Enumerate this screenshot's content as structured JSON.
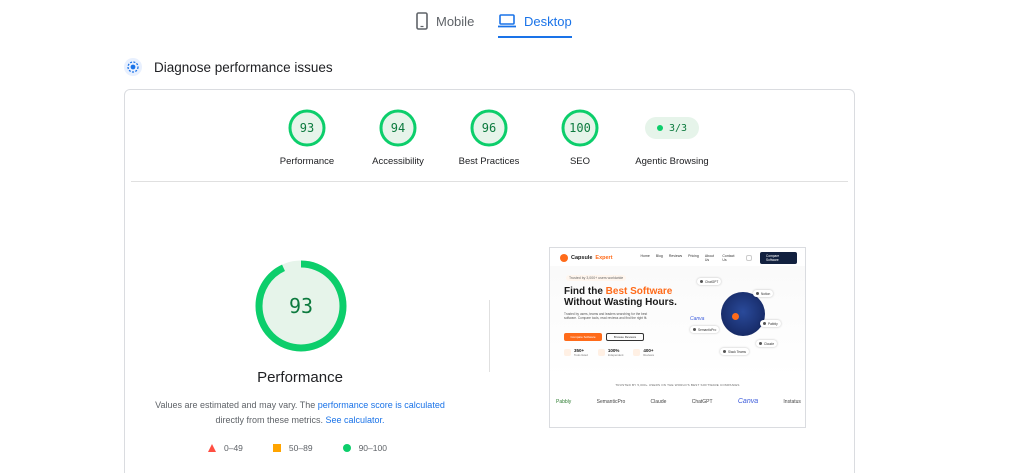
{
  "tabs": [
    {
      "label": "Mobile",
      "icon": "phone-icon",
      "active": false
    },
    {
      "label": "Desktop",
      "icon": "laptop-icon",
      "active": true
    }
  ],
  "section": {
    "title": "Diagnose performance issues",
    "icon": "diagnose-icon"
  },
  "categories": [
    {
      "score": "93",
      "label": "Performance"
    },
    {
      "score": "94",
      "label": "Accessibility"
    },
    {
      "score": "96",
      "label": "Best Practices"
    },
    {
      "score": "100",
      "label": "SEO"
    },
    {
      "score": "3/3",
      "label": "Agentic Browsing"
    }
  ],
  "performance": {
    "score": "93",
    "title": "Performance",
    "note_prefix": "Values are estimated and may vary. The ",
    "note_link1": "performance score is calculated",
    "note_middle": " directly from these metrics. ",
    "note_link2": "See calculator.",
    "legend": [
      {
        "range": "0–49",
        "shape": "triangle",
        "color": "#ff4e42"
      },
      {
        "range": "50–89",
        "shape": "square",
        "color": "#ffa400"
      },
      {
        "range": "90–100",
        "shape": "circle",
        "color": "#0cce6b"
      }
    ]
  },
  "colors": {
    "pass": "#0cce6b",
    "pass_text": "#0c7a3e",
    "accent": "#1a73e8"
  },
  "thumbnail": {
    "brand_a": "Capsule",
    "brand_b": "Expert",
    "nav": [
      "Home",
      "Blog",
      "Reviews",
      "Pricing",
      "About Us",
      "Contact Us"
    ],
    "cta": "Compare Software",
    "badge": "Trusted by 3,000+ users worldwide",
    "headline_a": "Find the ",
    "headline_hl": "Best Software",
    "headline_b": "Without Wasting Hours.",
    "body": "Trusted by users, teams and leaders searching for the best software. Compare tools, read reviews and find the right fit.",
    "btn_primary": "Compare Software",
    "btn_secondary": "Browse Reviews",
    "stats": [
      {
        "n": "350+",
        "s": "Tools listed"
      },
      {
        "n": "100%",
        "s": "Independent"
      },
      {
        "n": "400+",
        "s": "Reviews"
      }
    ],
    "chips": [
      "ChatGPT",
      "Notion",
      "Pabbly",
      "Claude",
      "Slack Teams",
      "SemanticPro"
    ],
    "canva": "Canva",
    "trust": "TRUSTED BY 5,000+ USERS ON THE WORLD'S BEST SOFTWARE COMPANIES",
    "logos": [
      "Pabbly",
      "SemanticPro",
      "Claude",
      "ChatGPT",
      "Canva",
      "Instatus"
    ]
  }
}
